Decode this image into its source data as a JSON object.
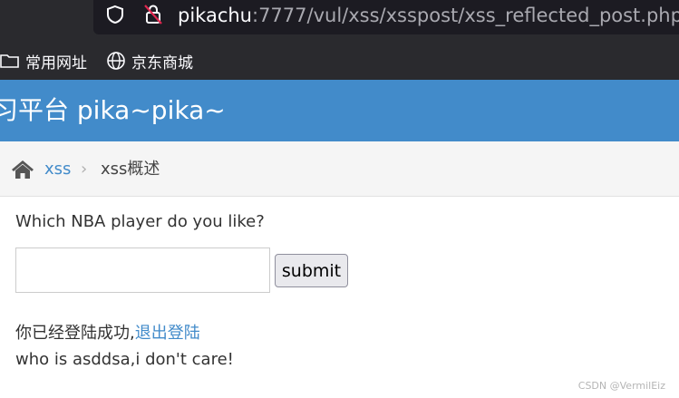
{
  "browser": {
    "url_host": "pikachu",
    "url_rest": ":7777/vul/xss/xsspost/xss_reflected_post.php",
    "bookmarks": [
      {
        "label": "常用网址",
        "icon": "folder-icon"
      },
      {
        "label": "京东商城",
        "icon": "globe-icon"
      }
    ]
  },
  "header": {
    "title": "习平台 pika~pika~",
    "bg_color": "#428bca"
  },
  "breadcrumb": {
    "home_icon": "home-icon",
    "link": "xss",
    "separator": "›",
    "current": "xss概述"
  },
  "form": {
    "question": "Which NBA player do you like?",
    "input_value": "",
    "submit_label": "submit"
  },
  "result": {
    "login_text": "你已经登陆成功,",
    "logout_link": "退出登陆",
    "response_text": "who is asddsa,i don't care!"
  },
  "watermark": "CSDN @VermilEiz"
}
